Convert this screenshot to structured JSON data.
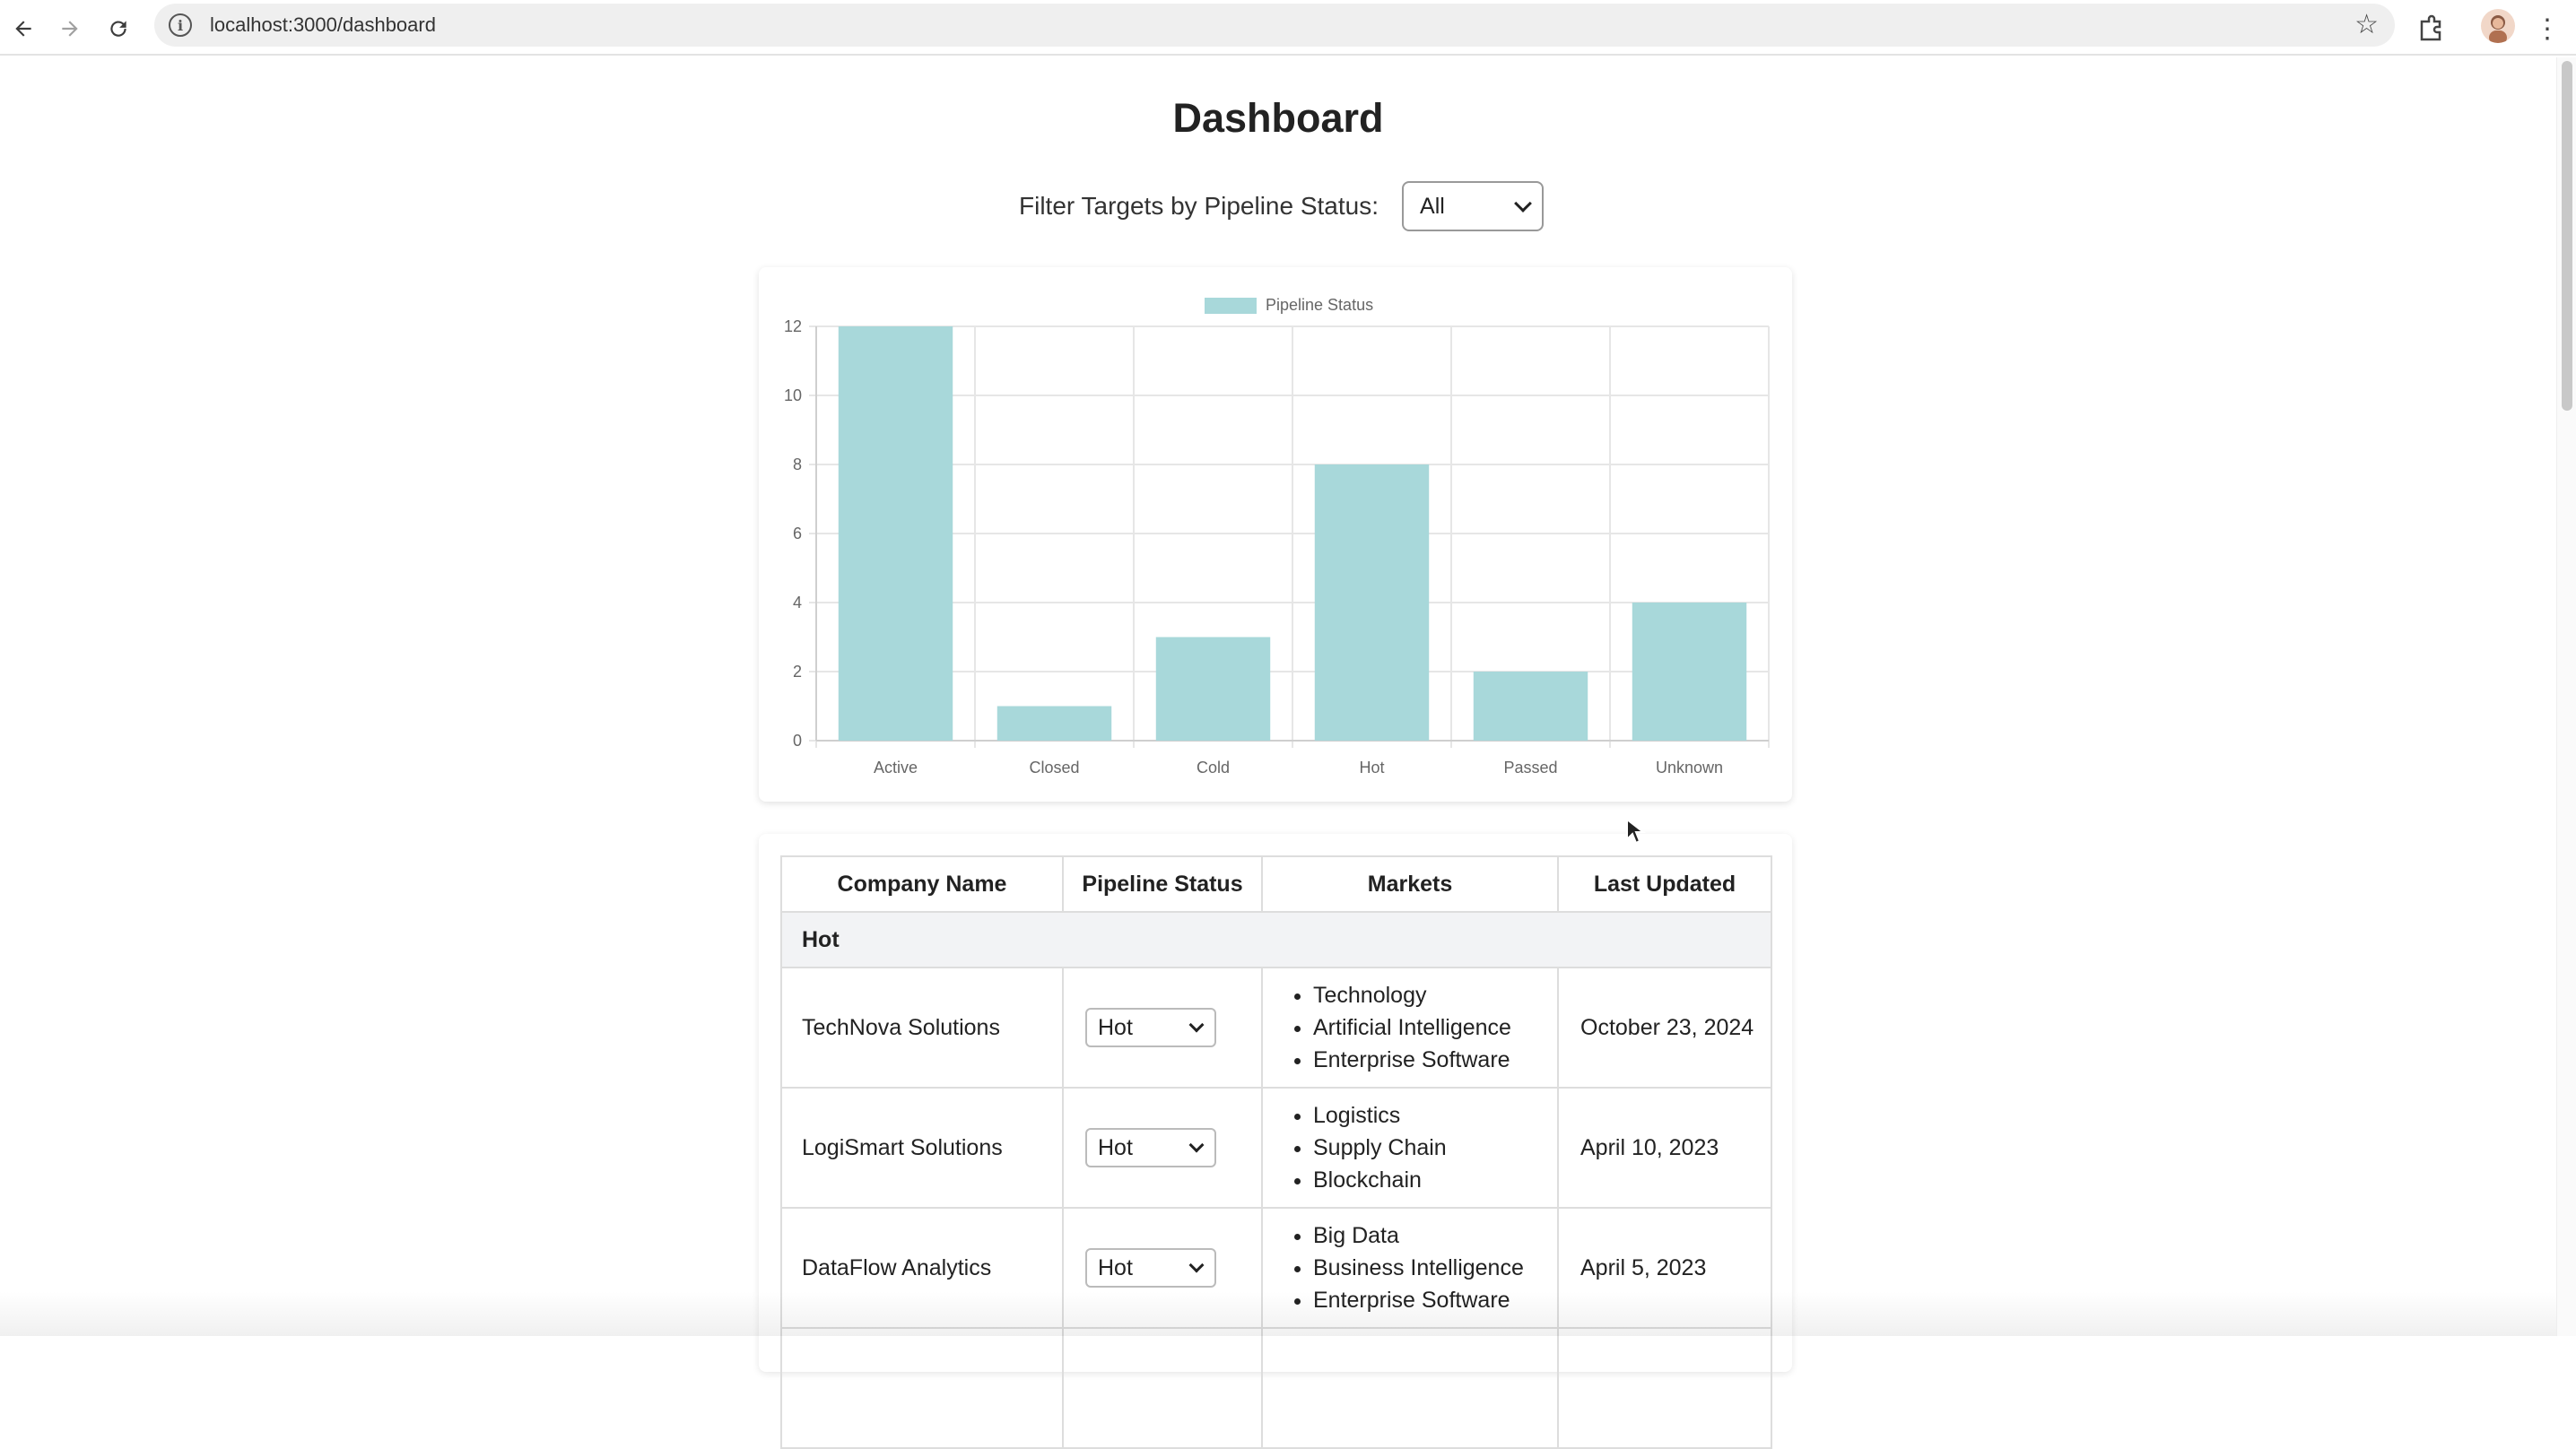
{
  "browser": {
    "url": "localhost:3000/dashboard",
    "icons": [
      "back-icon",
      "forward-icon",
      "reload-icon",
      "info-icon",
      "bookmark-star-icon",
      "extensions-icon",
      "profile-avatar",
      "menu-icon"
    ]
  },
  "page": {
    "title": "Dashboard",
    "filter_label": "Filter Targets by Pipeline Status:",
    "filter_value": "All"
  },
  "colors": {
    "bar_fill": "#a8d8da",
    "grid": "#e6e6e6",
    "group_row_bg": "#f2f3f5"
  },
  "chart_data": {
    "type": "bar",
    "categories": [
      "Active",
      "Closed",
      "Cold",
      "Hot",
      "Passed",
      "Unknown"
    ],
    "series": [
      {
        "name": "Pipeline Status",
        "values": [
          12,
          1,
          3,
          8,
          2,
          4
        ]
      }
    ],
    "y_ticks": [
      "0",
      "2",
      "4",
      "6",
      "8",
      "10",
      "12"
    ],
    "ylim": [
      0,
      12
    ],
    "legend_position": "top-center",
    "grid": true
  },
  "table": {
    "headers": [
      "Company Name",
      "Pipeline Status",
      "Markets",
      "Last Updated"
    ],
    "group": "Hot",
    "rows": [
      {
        "name": "TechNova Solutions",
        "status": "Hot",
        "markets": [
          "Technology",
          "Artificial Intelligence",
          "Enterprise Software"
        ],
        "updated": "October 23, 2024"
      },
      {
        "name": "LogiSmart Solutions",
        "status": "Hot",
        "markets": [
          "Logistics",
          "Supply Chain",
          "Blockchain"
        ],
        "updated": "April 10, 2023"
      },
      {
        "name": "DataFlow Analytics",
        "status": "Hot",
        "markets": [
          "Big Data",
          "Business Intelligence",
          "Enterprise Software"
        ],
        "updated": "April 5, 2023"
      }
    ]
  }
}
